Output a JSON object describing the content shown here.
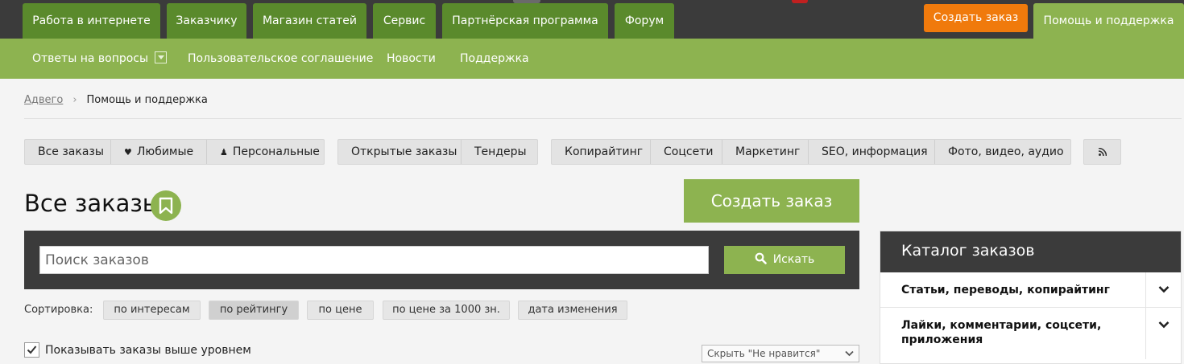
{
  "top_nav": {
    "tabs": [
      {
        "label": "Работа в интернете"
      },
      {
        "label": "Заказчику"
      },
      {
        "label": "Магазин статей"
      },
      {
        "label": "Сервис"
      },
      {
        "label": "Партнёрская программа"
      },
      {
        "label": "Форум"
      }
    ],
    "create_order": "Создать заказ",
    "help": "Помощь и поддержка"
  },
  "sub_nav": {
    "items": [
      {
        "label": "Ответы на вопросы"
      },
      {
        "label": "Пользовательское соглашение"
      },
      {
        "label": "Новости"
      },
      {
        "label": "Поддержка"
      }
    ]
  },
  "breadcrumb": {
    "root": "Адвего",
    "separator": "›",
    "current": "Помощь и поддержка"
  },
  "filters": {
    "group1": [
      {
        "label": "Все заказы",
        "icon": ""
      },
      {
        "label": "Любимые",
        "icon": "heart-icon"
      },
      {
        "label": "Персональные",
        "icon": "user-icon"
      }
    ],
    "group2": [
      {
        "label": "Открытые заказы"
      },
      {
        "label": "Тендеры"
      }
    ],
    "group3": [
      {
        "label": "Копирайтинг"
      },
      {
        "label": "Соцсети"
      },
      {
        "label": "Маркетинг"
      },
      {
        "label": "SEO, информация"
      },
      {
        "label": "Фото, видео, аудио"
      }
    ],
    "rss_icon": "rss-icon"
  },
  "page": {
    "title": "Все заказы",
    "create_button": "Создать заказ"
  },
  "search": {
    "placeholder": "Поиск заказов",
    "button": "Искать"
  },
  "sort": {
    "label": "Сортировка:",
    "options": [
      {
        "label": "по интересам"
      },
      {
        "label": "по рейтингу"
      },
      {
        "label": "по цене"
      },
      {
        "label": "по цене за 1000 зн."
      },
      {
        "label": "дата изменения"
      }
    ],
    "active": "по рейтингу"
  },
  "show_higher_level": {
    "label": "Показывать заказы выше уровнем",
    "checked": true
  },
  "hide_filter": {
    "value": "Скрыть \"Не нравится\""
  },
  "catalog": {
    "title": "Каталог заказов",
    "items": [
      {
        "label": "Статьи, переводы, копирайтинг"
      },
      {
        "label": "Лайки, комментарии, соцсети, приложения"
      }
    ]
  },
  "colors": {
    "dark": "#3b3b3b",
    "green_dark": "#5a8a2c",
    "green": "#8db350",
    "orange": "#f07a0c"
  }
}
